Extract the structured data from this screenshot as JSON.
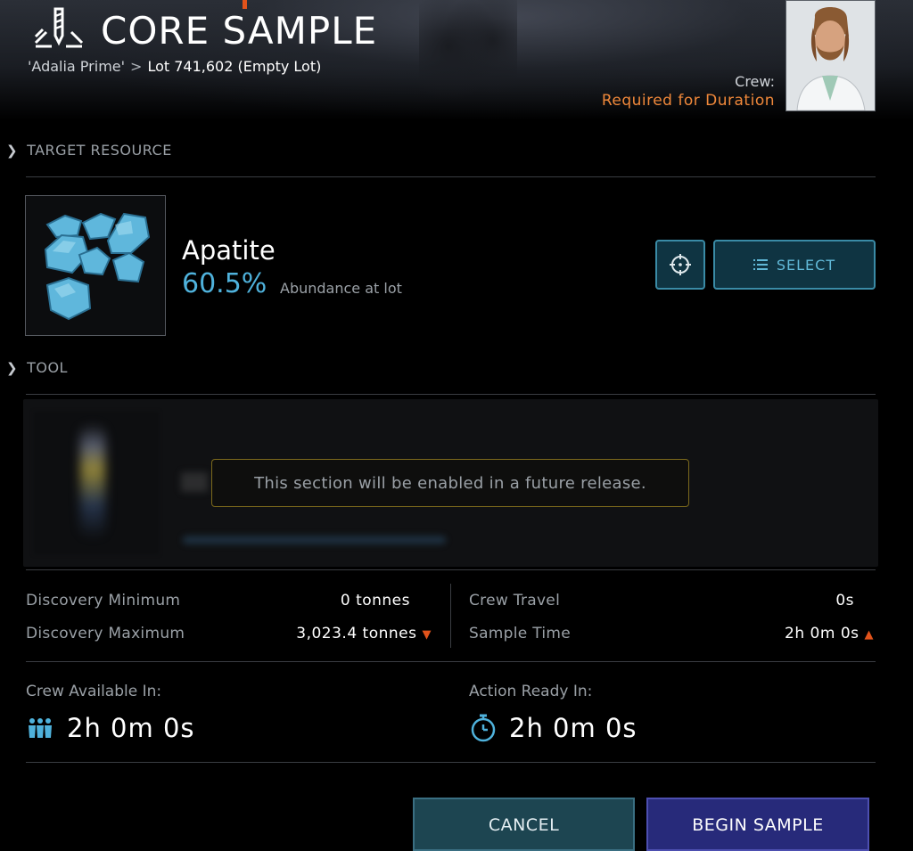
{
  "header": {
    "title": "CORE SAMPLE",
    "breadcrumb": {
      "asteroid": "'Adalia Prime'",
      "separator": ">",
      "lot": "Lot 741,602 (Empty Lot)"
    },
    "crew_label": "Crew:",
    "crew_requirement": "Required for Duration",
    "accent_color": "#f0883a"
  },
  "sections": {
    "target_resource": "TARGET RESOURCE",
    "tool": "TOOL"
  },
  "resource": {
    "name": "Apatite",
    "abundance_pct": "60.5%",
    "abundance_label": "Abundance at lot",
    "select_label": "SELECT",
    "target_icon": "crosshair-icon",
    "select_icon": "list-icon"
  },
  "tool": {
    "notice": "This section will be enabled in a future release."
  },
  "stats": {
    "discovery_min_label": "Discovery Minimum",
    "discovery_min_value": "0 tonnes",
    "discovery_max_label": "Discovery Maximum",
    "discovery_max_value": "3,023.4 tonnes",
    "crew_travel_label": "Crew Travel",
    "crew_travel_value": "0s",
    "sample_time_label": "Sample Time",
    "sample_time_value": "2h 0m 0s"
  },
  "availability": {
    "crew_label": "Crew Available In:",
    "crew_value": "2h 0m 0s",
    "crew_icon": "crew-icon",
    "action_label": "Action Ready In:",
    "action_value": "2h 0m 0s",
    "action_icon": "stopwatch-icon"
  },
  "footer": {
    "cancel_label": "CANCEL",
    "begin_label": "BEGIN SAMPLE"
  }
}
